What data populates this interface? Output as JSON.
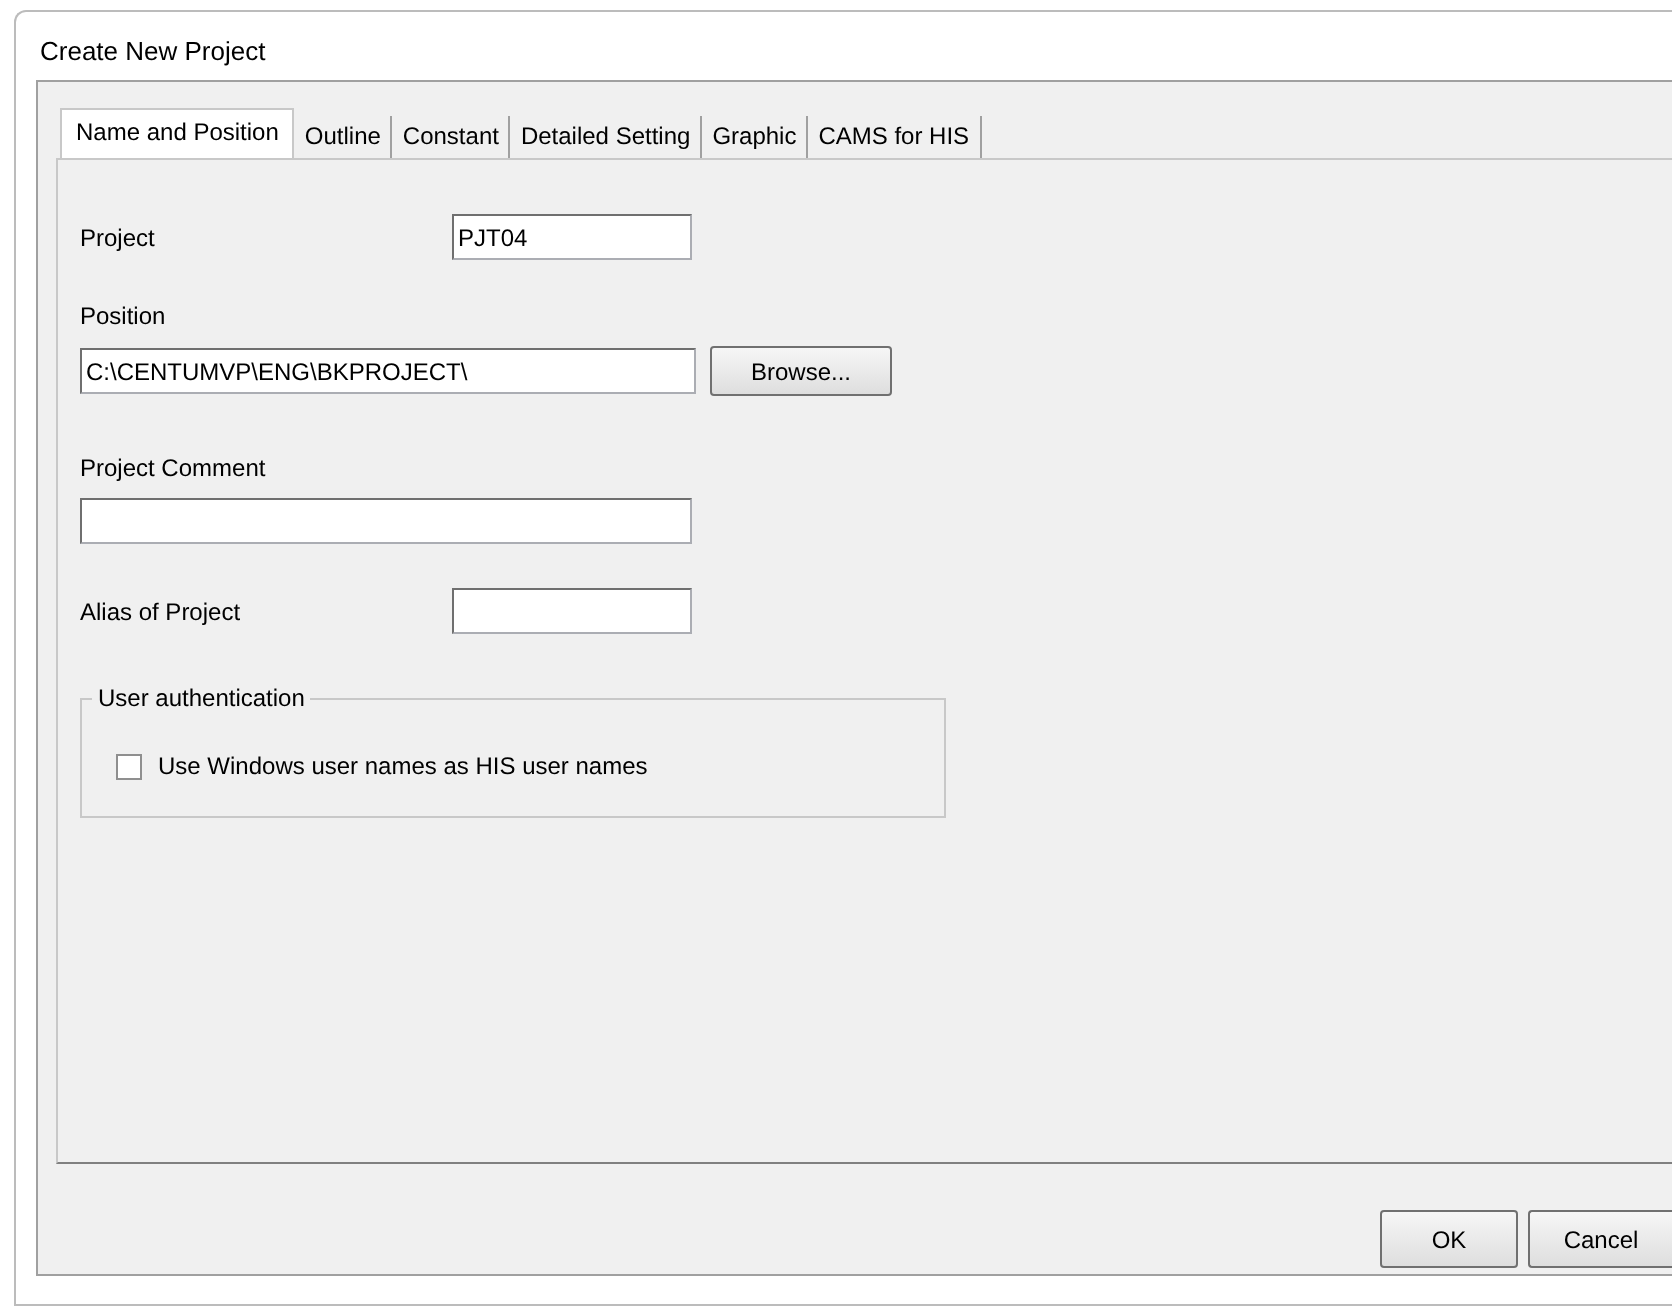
{
  "window": {
    "title": "Create New Project"
  },
  "tabs": [
    {
      "label": "Name and Position",
      "selected": true
    },
    {
      "label": "Outline",
      "selected": false
    },
    {
      "label": "Constant",
      "selected": false
    },
    {
      "label": "Detailed Setting",
      "selected": false
    },
    {
      "label": "Graphic",
      "selected": false
    },
    {
      "label": "CAMS for HIS",
      "selected": false
    }
  ],
  "project": {
    "label": "Project",
    "value": "PJT04"
  },
  "position": {
    "label": "Position",
    "value": "C:\\CENTUMVP\\ENG\\BKPROJECT\\",
    "browse_button": "Browse..."
  },
  "project_comment": {
    "label": "Project Comment"
  },
  "alias": {
    "label": "Alias of Project"
  },
  "user_authentication": {
    "legend": "User authentication",
    "checkbox": {
      "label": "Use Windows user names as HIS user names",
      "checked": false
    }
  },
  "buttons": [
    "OK",
    "Cancel"
  ]
}
